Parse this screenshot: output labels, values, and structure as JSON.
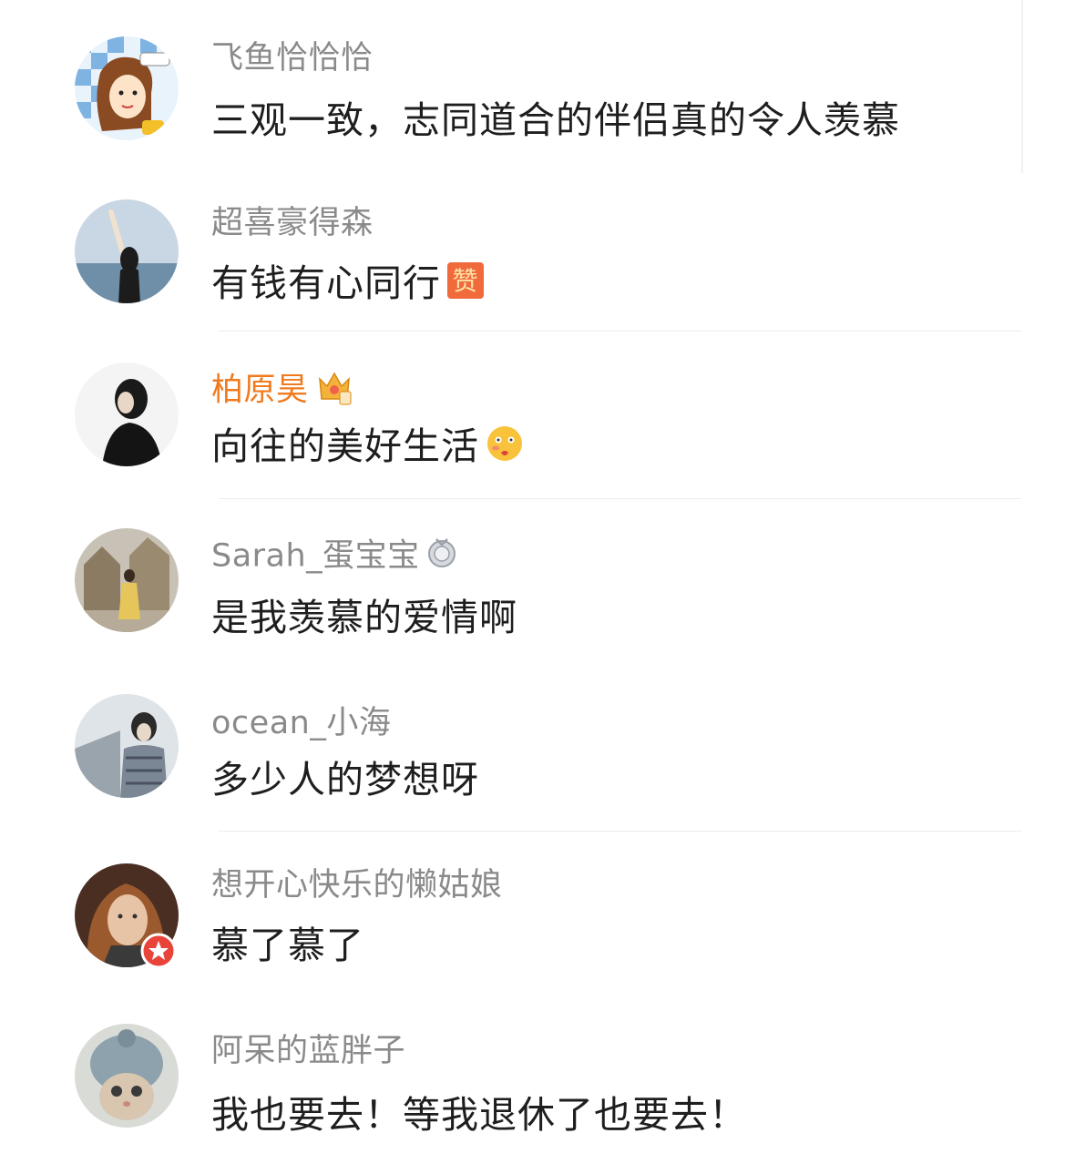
{
  "comments": [
    {
      "username": "飞鱼恰恰恰",
      "text": "三观一致，志同道合的伴侣真的令人羡慕"
    },
    {
      "username": "超喜豪得森",
      "text": "有钱有心同行",
      "emoji": "赞"
    },
    {
      "username": "柏原昊",
      "text": "向往的美好生活",
      "badge_icon": "crown-icon",
      "emoji_icon": "blush-face-icon"
    },
    {
      "username": "Sarah_蛋宝宝",
      "text": "是我羡慕的爱情啊",
      "badge_icon": "medal-icon"
    },
    {
      "username": "ocean_小海",
      "text": "多少人的梦想呀"
    },
    {
      "username": "想开心快乐的懒姑娘",
      "text": "慕了慕了",
      "badge_icon": "star-badge-icon"
    },
    {
      "username": "阿呆的蓝胖子",
      "text": "我也要去！等我退休了也要去！"
    }
  ],
  "colors": {
    "vip_name": "#f07b1f",
    "name": "#8a8a8a",
    "text": "#1e1e1e"
  }
}
